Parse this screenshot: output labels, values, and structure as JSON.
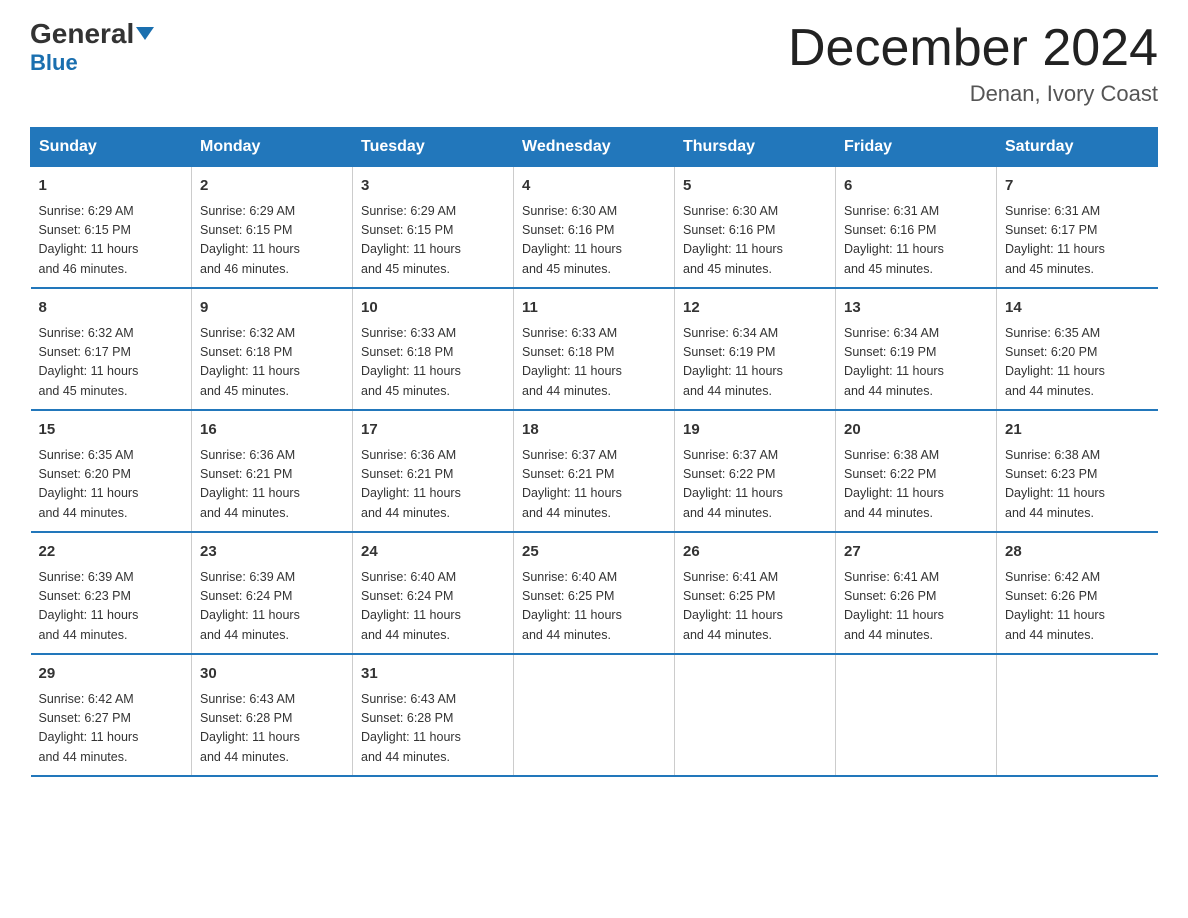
{
  "logo": {
    "brand": "General",
    "sub": "Blue"
  },
  "title": "December 2024",
  "location": "Denan, Ivory Coast",
  "days_of_week": [
    "Sunday",
    "Monday",
    "Tuesday",
    "Wednesday",
    "Thursday",
    "Friday",
    "Saturday"
  ],
  "weeks": [
    [
      {
        "day": "1",
        "sunrise": "6:29 AM",
        "sunset": "6:15 PM",
        "daylight": "11 hours and 46 minutes."
      },
      {
        "day": "2",
        "sunrise": "6:29 AM",
        "sunset": "6:15 PM",
        "daylight": "11 hours and 46 minutes."
      },
      {
        "day": "3",
        "sunrise": "6:29 AM",
        "sunset": "6:15 PM",
        "daylight": "11 hours and 45 minutes."
      },
      {
        "day": "4",
        "sunrise": "6:30 AM",
        "sunset": "6:16 PM",
        "daylight": "11 hours and 45 minutes."
      },
      {
        "day": "5",
        "sunrise": "6:30 AM",
        "sunset": "6:16 PM",
        "daylight": "11 hours and 45 minutes."
      },
      {
        "day": "6",
        "sunrise": "6:31 AM",
        "sunset": "6:16 PM",
        "daylight": "11 hours and 45 minutes."
      },
      {
        "day": "7",
        "sunrise": "6:31 AM",
        "sunset": "6:17 PM",
        "daylight": "11 hours and 45 minutes."
      }
    ],
    [
      {
        "day": "8",
        "sunrise": "6:32 AM",
        "sunset": "6:17 PM",
        "daylight": "11 hours and 45 minutes."
      },
      {
        "day": "9",
        "sunrise": "6:32 AM",
        "sunset": "6:18 PM",
        "daylight": "11 hours and 45 minutes."
      },
      {
        "day": "10",
        "sunrise": "6:33 AM",
        "sunset": "6:18 PM",
        "daylight": "11 hours and 45 minutes."
      },
      {
        "day": "11",
        "sunrise": "6:33 AM",
        "sunset": "6:18 PM",
        "daylight": "11 hours and 44 minutes."
      },
      {
        "day": "12",
        "sunrise": "6:34 AM",
        "sunset": "6:19 PM",
        "daylight": "11 hours and 44 minutes."
      },
      {
        "day": "13",
        "sunrise": "6:34 AM",
        "sunset": "6:19 PM",
        "daylight": "11 hours and 44 minutes."
      },
      {
        "day": "14",
        "sunrise": "6:35 AM",
        "sunset": "6:20 PM",
        "daylight": "11 hours and 44 minutes."
      }
    ],
    [
      {
        "day": "15",
        "sunrise": "6:35 AM",
        "sunset": "6:20 PM",
        "daylight": "11 hours and 44 minutes."
      },
      {
        "day": "16",
        "sunrise": "6:36 AM",
        "sunset": "6:21 PM",
        "daylight": "11 hours and 44 minutes."
      },
      {
        "day": "17",
        "sunrise": "6:36 AM",
        "sunset": "6:21 PM",
        "daylight": "11 hours and 44 minutes."
      },
      {
        "day": "18",
        "sunrise": "6:37 AM",
        "sunset": "6:21 PM",
        "daylight": "11 hours and 44 minutes."
      },
      {
        "day": "19",
        "sunrise": "6:37 AM",
        "sunset": "6:22 PM",
        "daylight": "11 hours and 44 minutes."
      },
      {
        "day": "20",
        "sunrise": "6:38 AM",
        "sunset": "6:22 PM",
        "daylight": "11 hours and 44 minutes."
      },
      {
        "day": "21",
        "sunrise": "6:38 AM",
        "sunset": "6:23 PM",
        "daylight": "11 hours and 44 minutes."
      }
    ],
    [
      {
        "day": "22",
        "sunrise": "6:39 AM",
        "sunset": "6:23 PM",
        "daylight": "11 hours and 44 minutes."
      },
      {
        "day": "23",
        "sunrise": "6:39 AM",
        "sunset": "6:24 PM",
        "daylight": "11 hours and 44 minutes."
      },
      {
        "day": "24",
        "sunrise": "6:40 AM",
        "sunset": "6:24 PM",
        "daylight": "11 hours and 44 minutes."
      },
      {
        "day": "25",
        "sunrise": "6:40 AM",
        "sunset": "6:25 PM",
        "daylight": "11 hours and 44 minutes."
      },
      {
        "day": "26",
        "sunrise": "6:41 AM",
        "sunset": "6:25 PM",
        "daylight": "11 hours and 44 minutes."
      },
      {
        "day": "27",
        "sunrise": "6:41 AM",
        "sunset": "6:26 PM",
        "daylight": "11 hours and 44 minutes."
      },
      {
        "day": "28",
        "sunrise": "6:42 AM",
        "sunset": "6:26 PM",
        "daylight": "11 hours and 44 minutes."
      }
    ],
    [
      {
        "day": "29",
        "sunrise": "6:42 AM",
        "sunset": "6:27 PM",
        "daylight": "11 hours and 44 minutes."
      },
      {
        "day": "30",
        "sunrise": "6:43 AM",
        "sunset": "6:28 PM",
        "daylight": "11 hours and 44 minutes."
      },
      {
        "day": "31",
        "sunrise": "6:43 AM",
        "sunset": "6:28 PM",
        "daylight": "11 hours and 44 minutes."
      },
      null,
      null,
      null,
      null
    ]
  ],
  "labels": {
    "sunrise": "Sunrise:",
    "sunset": "Sunset:",
    "daylight": "Daylight:"
  }
}
